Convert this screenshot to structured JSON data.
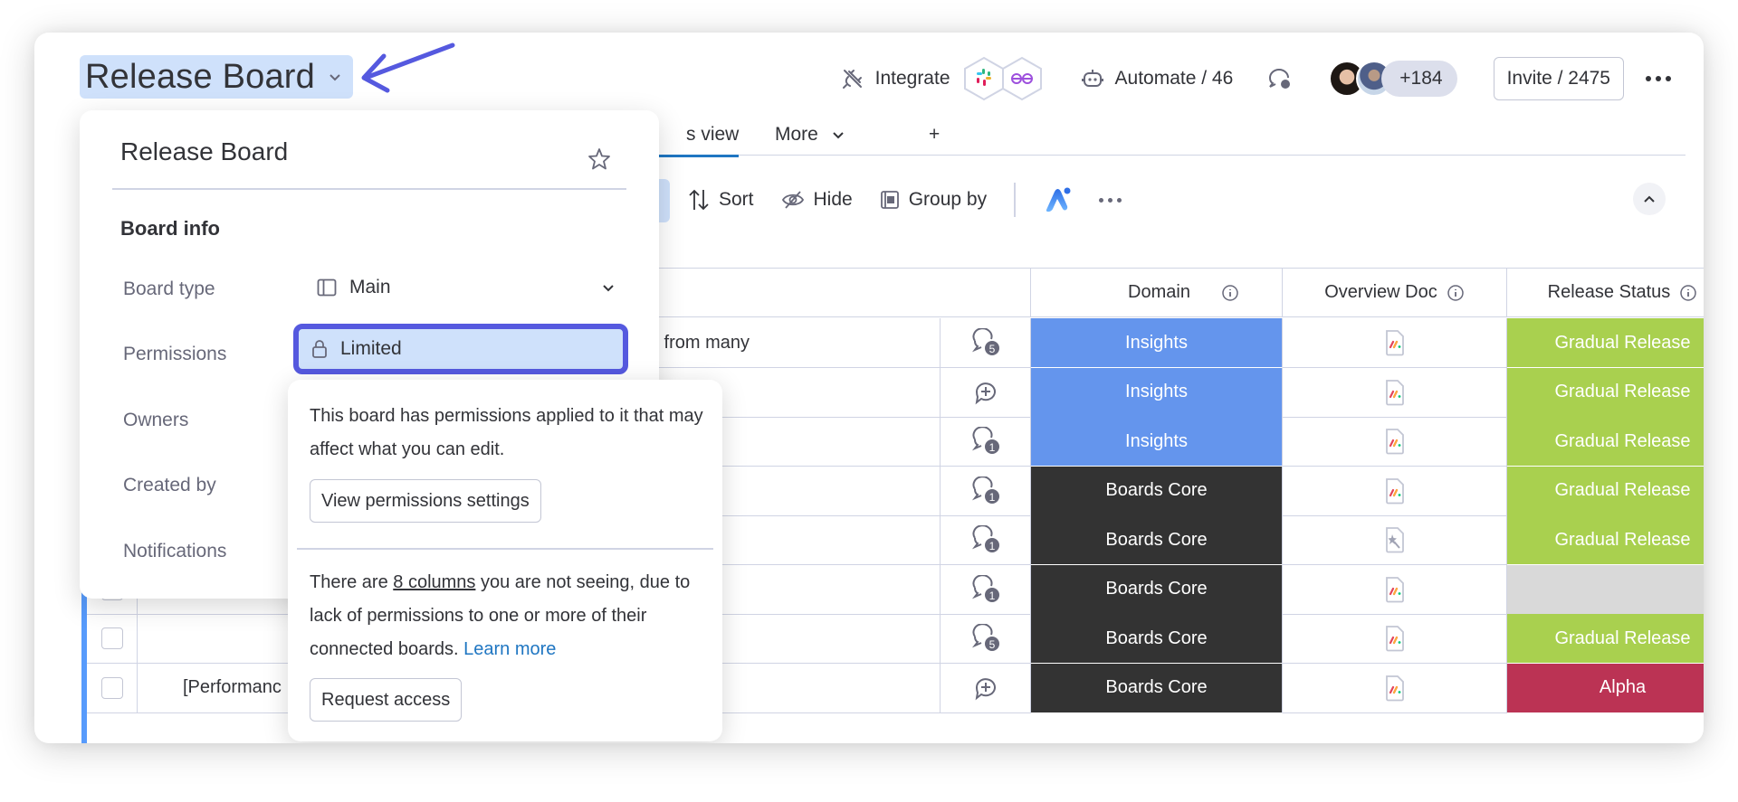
{
  "header": {
    "board_title": "Release Board",
    "integrate_label": "Integrate",
    "automate_label": "Automate / 46",
    "members_extra": "+184",
    "invite_label": "Invite / 2475"
  },
  "tabs": {
    "active_partial": "s view",
    "more_label": "More",
    "add_label": "+"
  },
  "toolbar": {
    "sort_label": "Sort",
    "hide_label": "Hide",
    "group_by_label": "Group by"
  },
  "table": {
    "columns": [
      {
        "label": "Domain"
      },
      {
        "label": "Overview Doc"
      },
      {
        "label": "Release Status"
      }
    ],
    "rows": [
      {
        "name": "s from many",
        "updates": "5",
        "domain": "Insights",
        "domain_color": "#6495ed",
        "doc": "monday-doc",
        "status": "Gradual Release",
        "status_color": "#a9d04f"
      },
      {
        "name": "",
        "updates": "+",
        "domain": "Insights",
        "domain_color": "#6495ed",
        "doc": "monday-doc",
        "status": "Gradual Release",
        "status_color": "#a9d04f"
      },
      {
        "name": "",
        "updates": "1",
        "domain": "Insights",
        "domain_color": "#6495ed",
        "doc": "monday-doc",
        "status": "Gradual Release",
        "status_color": "#a9d04f"
      },
      {
        "name": "",
        "updates": "1",
        "domain": "Boards Core",
        "domain_color": "#333333",
        "doc": "monday-doc",
        "status": "Gradual Release",
        "status_color": "#a9d04f"
      },
      {
        "name": "",
        "updates": "1",
        "domain": "Boards Core",
        "domain_color": "#333333",
        "doc": "magic-doc",
        "status": "Gradual Release",
        "status_color": "#a9d04f"
      },
      {
        "name": "",
        "updates": "1",
        "domain": "Boards Core",
        "domain_color": "#333333",
        "doc": "monday-doc",
        "status": "",
        "status_color": "#d9d9d9"
      },
      {
        "name": "",
        "updates": "5",
        "domain": "Boards Core",
        "domain_color": "#333333",
        "doc": "monday-doc",
        "status": "Gradual Release",
        "status_color": "#a9d04f"
      },
      {
        "name": "[Performanc",
        "updates": "+",
        "domain": "Boards Core",
        "domain_color": "#333333",
        "doc": "monday-doc",
        "status": "Alpha",
        "status_color": "#bb3354"
      }
    ]
  },
  "board_info": {
    "title": "Release Board",
    "section": "Board info",
    "board_type_label": "Board type",
    "board_type_value": "Main",
    "permissions_label": "Permissions",
    "permissions_value": "Limited",
    "owners_label": "Owners",
    "created_by_label": "Created by",
    "notifications_label": "Notifications"
  },
  "permissions_tooltip": {
    "text1": "This board has permissions applied to it that may affect what you can edit.",
    "view_settings_button": "View permissions settings",
    "text2_prefix": "There are ",
    "text2_link": "8 columns",
    "text2_suffix": " you are not seeing, due to lack of permissions to one or more of their connected boards. ",
    "learn_more": "Learn more",
    "request_access_button": "Request access"
  },
  "colors": {
    "accent": "#5559df",
    "selection": "#cfe1fb",
    "link": "#1f76c2"
  }
}
